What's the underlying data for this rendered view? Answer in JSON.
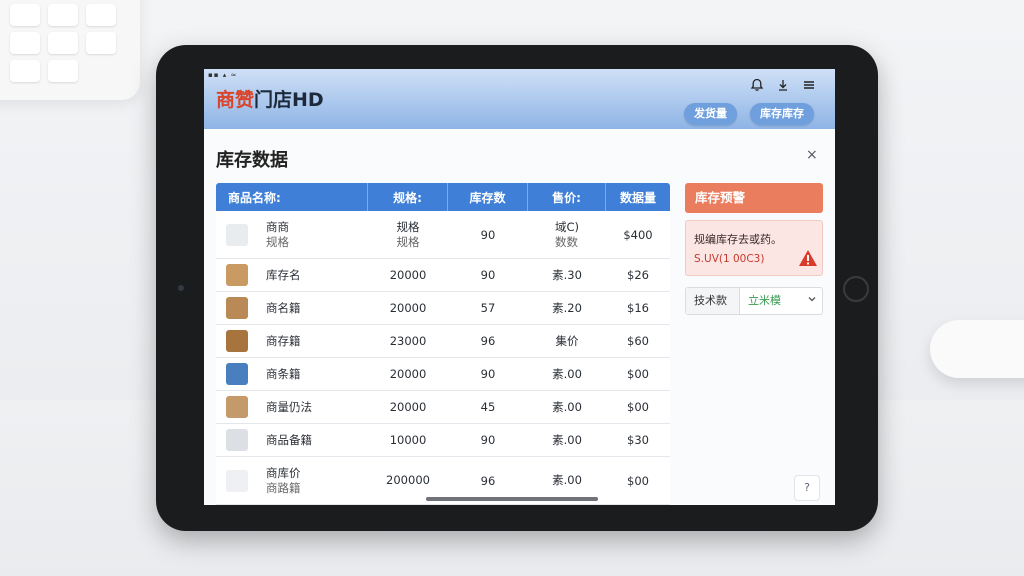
{
  "app": {
    "title_brand": "商赞",
    "title_rest": "门店HD",
    "header_buttons": [
      "发货量",
      "库存库存"
    ],
    "status_bar": "▪▪ ▴ ≈"
  },
  "page": {
    "title": "库存数据",
    "close": "×"
  },
  "table": {
    "headers": [
      "商品名称:",
      "规格:",
      "库存数",
      "售价:",
      "数据量"
    ],
    "rows": [
      {
        "name": "商商",
        "name_sub": "规格",
        "spec": "规格",
        "spec_sub": "规格",
        "stock": "90",
        "price": "域C)",
        "price_sub": "数数",
        "amount": "$400",
        "tall": true,
        "thumb": "#e9ecef"
      },
      {
        "name": "库存名",
        "spec": "20000",
        "stock": "90",
        "price": "素.30",
        "amount": "$26",
        "thumb": "#c99a62"
      },
      {
        "name": "商名籍",
        "spec": "20000",
        "stock": "57",
        "price": "素.20",
        "amount": "$16",
        "thumb": "#b98a56"
      },
      {
        "name": "商存籍",
        "spec": "23000",
        "stock": "96",
        "price": "集价",
        "amount": "$60",
        "thumb": "#a8743e"
      },
      {
        "name": "商条籍",
        "spec": "20000",
        "stock": "90",
        "price": "素.00",
        "amount": "$00",
        "thumb": "#4a7fbf"
      },
      {
        "name": "商量仍法",
        "spec": "20000",
        "stock": "45",
        "price": "素.00",
        "amount": "$00",
        "thumb": "#c59a6a"
      },
      {
        "name": "商品备籍",
        "spec": "10000",
        "stock": "90",
        "price": "素.00",
        "amount": "$30",
        "thumb": "#dcdfe3"
      },
      {
        "name": "商库价",
        "name_sub": "商路籍",
        "spec": "200000",
        "stock": "96",
        "price": "素.00",
        "amount": "$00",
        "tall": true,
        "thumb": "#eef0f3"
      }
    ]
  },
  "panel": {
    "warn_title": "库存预警",
    "warn_text": "规编库存去或药。",
    "warn_code": "S.UV(1 00C3)",
    "filter_label": "技术款",
    "filter_value": "立米模",
    "corner": "?"
  },
  "colors": {
    "header_blue": "#3f7fd8",
    "warn_orange": "#ea7d5e",
    "warn_red": "#d93a2a"
  }
}
